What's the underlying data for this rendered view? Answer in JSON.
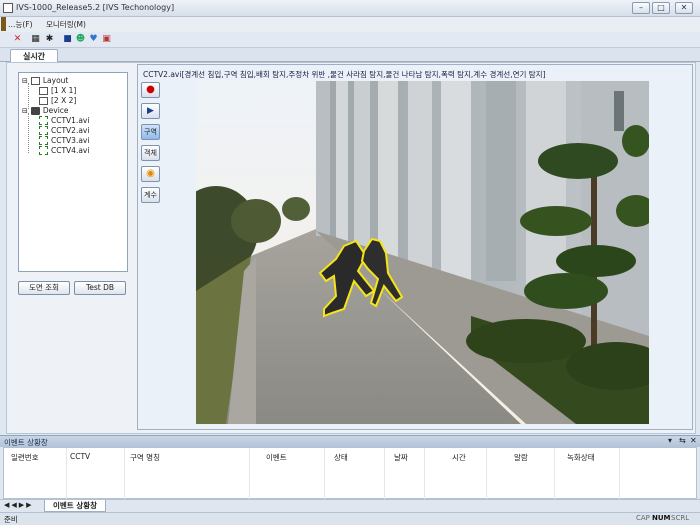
{
  "window": {
    "title": "IVS-1000_Release5.2 [IVS Techonology]"
  },
  "menu": [
    "…능(F)",
    "모니터링(M)"
  ],
  "tabs": {
    "live": "실시간"
  },
  "tree": {
    "layout": "Layout",
    "layout_items": [
      "[1 X 1]",
      "[2 X 2]"
    ],
    "device": "Device",
    "devices": [
      "CCTV1.avi",
      "CCTV2.avi",
      "CCTV3.avi",
      "CCTV4.avi"
    ]
  },
  "buttons": {
    "map_view": "도면 조회",
    "test_db": "Test DB"
  },
  "video": {
    "caption": "CCTV2.avi[경계선 침입,구역 침입,배회 탐지,주정차 위반 ,물건 사라짐 탐지,물건 나타남 탐지,폭력 탐지,계수 경계선,연기 탐지]",
    "side_buttons": [
      "구역",
      "객체",
      "계수"
    ]
  },
  "events": {
    "title": "이벤트 상황창",
    "columns": [
      "일련번호",
      "CCTV",
      "구역 명칭",
      "이벤트",
      "상태",
      "날짜",
      "시간",
      "알람",
      "녹화상태"
    ],
    "tab": "이벤트 상황창"
  },
  "status": {
    "left": "준비",
    "indicators": [
      "CAP",
      "NUM",
      "SCRL"
    ]
  }
}
